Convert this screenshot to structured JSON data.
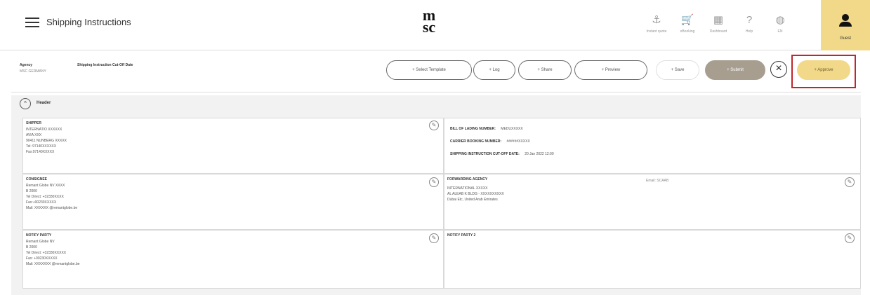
{
  "header": {
    "title": "Shipping Instructions",
    "logo": "msc",
    "nav": [
      {
        "icon": "anchor-icon",
        "glyph": "⚓",
        "label": "Instant quote"
      },
      {
        "icon": "cart-icon",
        "glyph": "🛒",
        "label": "eBooking"
      },
      {
        "icon": "dashboard-icon",
        "glyph": "▦",
        "label": "Dashboard"
      },
      {
        "icon": "help-icon",
        "glyph": "?",
        "label": "Help"
      },
      {
        "icon": "globe-icon",
        "glyph": "◍",
        "label": "EN"
      }
    ],
    "guest_label": "Guest"
  },
  "action_bar": {
    "agency_label": "Agency",
    "agency_value": "MSC GERMANY",
    "cutoff_label": "Shipping Instruction Cut-Off Date",
    "buttons": {
      "select_template": "+ Select Template",
      "log": "+ Log",
      "share": "+ Share",
      "preview": "+ Preview",
      "save": "+ Save",
      "submit": "+ Submit",
      "approve": "+ Approve"
    },
    "close_glyph": "×"
  },
  "section": {
    "title": "Header",
    "collapse_glyph": "⌃",
    "edit_glyph": "✎",
    "shipper": {
      "title": "SHIPPER",
      "lines": [
        "INTERNATIO XXXXXX",
        "AVIA XXX",
        "90411 NUNBERG XXXXX",
        "Tel: 97140XXXXXX",
        "Fax:97140XXXXX"
      ]
    },
    "details": {
      "bl_label": "BILL OF LADING NUMBER:",
      "bl_value": "MEDUXXXXX",
      "booking_label": "CARRIER BOOKING NUMBER:",
      "booking_value": "######XXXXX",
      "cutoff_label": "SHIPPING INSTRUCTION CUT-OFF DATE:",
      "cutoff_value": "20 Jan 2022 12:00"
    },
    "consignee": {
      "title": "CONSIGNEE",
      "lines": [
        "Remant Globe NV XXXX",
        "B 2000",
        "Tel Direct: +32330XXXX",
        "Fax:+00230XXXXX",
        "Mail: XXXXXX @remantglobe.be"
      ]
    },
    "forwarding": {
      "title": "FORWARDING AGENCY",
      "email": "Email: SCAAB",
      "lines": [
        "INTERNATIONAL XXXXX",
        "AL ALEAB K BLDG - XXXXXXXXXX",
        "Dubai Etc, United Arab Emirates"
      ]
    },
    "notify": {
      "title": "NOTIFY PARTY",
      "lines": [
        "Remant Globe NV",
        "B 2000",
        "Tel Direct: +32330XXXXX",
        "Fax: +00230XXXXX",
        "Mail: XXXXXXX @remantglobe.be"
      ]
    },
    "notify2": {
      "title": "NOTIFY PARTY 2",
      "lines": []
    }
  }
}
